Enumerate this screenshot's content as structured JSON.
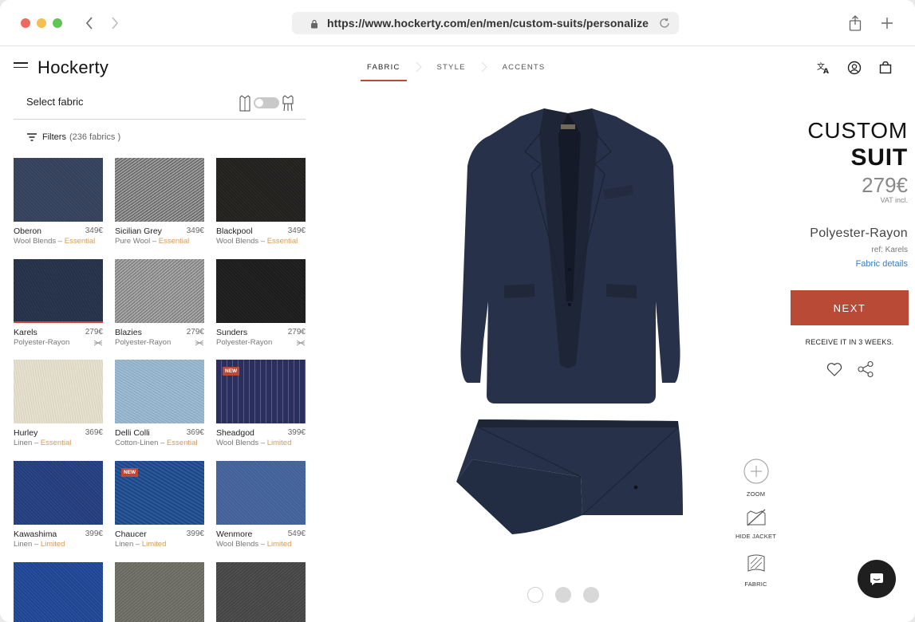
{
  "browser": {
    "url": "https://www.hockerty.com/en/men/custom-suits/personalize"
  },
  "header": {
    "logo": "Hockerty",
    "steps": [
      {
        "label": "FABRIC",
        "active": true
      },
      {
        "label": "STYLE",
        "active": false
      },
      {
        "label": "ACCENTS",
        "active": false
      }
    ]
  },
  "sidebar": {
    "title": "Select fabric",
    "filters_label": "Filters",
    "filters_count": "(236 fabrics )",
    "fabrics": [
      {
        "name": "Oberon",
        "price": "349€",
        "material": "Wool Blends",
        "tag": "Essential"
      },
      {
        "name": "Sicilian Grey",
        "price": "349€",
        "material": "Pure Wool",
        "tag": "Essential"
      },
      {
        "name": "Blackpool",
        "price": "349€",
        "material": "Wool Blends",
        "tag": "Essential"
      },
      {
        "name": "Karels",
        "price": "279€",
        "material": "Polyester-Rayon",
        "tag": ""
      },
      {
        "name": "Blazies",
        "price": "279€",
        "material": "Polyester-Rayon",
        "tag": ""
      },
      {
        "name": "Sunders",
        "price": "279€",
        "material": "Polyester-Rayon",
        "tag": ""
      },
      {
        "name": "Hurley",
        "price": "369€",
        "material": "Linen",
        "tag": "Essential"
      },
      {
        "name": "Delli Colli",
        "price": "369€",
        "material": "Cotton-Linen",
        "tag": "Essential"
      },
      {
        "name": "Sheadgod",
        "price": "399€",
        "material": "Wool Blends",
        "tag": "Limited"
      },
      {
        "name": "Kawashima",
        "price": "399€",
        "material": "Linen",
        "tag": "Limited"
      },
      {
        "name": "Chaucer",
        "price": "399€",
        "material": "Linen",
        "tag": "Limited"
      },
      {
        "name": "Wenmore",
        "price": "549€",
        "material": "Wool Blends",
        "tag": "Limited"
      }
    ],
    "new_badge": "NEW"
  },
  "product_tools": {
    "zoom": "ZOOM",
    "hide_jacket": "HIDE JACKET",
    "fabric": "FABRIC"
  },
  "summary": {
    "title_line1": "CUSTOM",
    "title_line2": "SUIT",
    "price": "279€",
    "vat": "VAT incl.",
    "fabric": "Polyester-Rayon",
    "ref": "ref: Karels",
    "details_link": "Fabric details",
    "next_label": "NEXT",
    "delivery": "RECEIVE IT IN 3 WEEKS."
  },
  "colors": {
    "accent": "#b84a36",
    "link": "#3a7cc3",
    "tag": "#d39a58"
  }
}
